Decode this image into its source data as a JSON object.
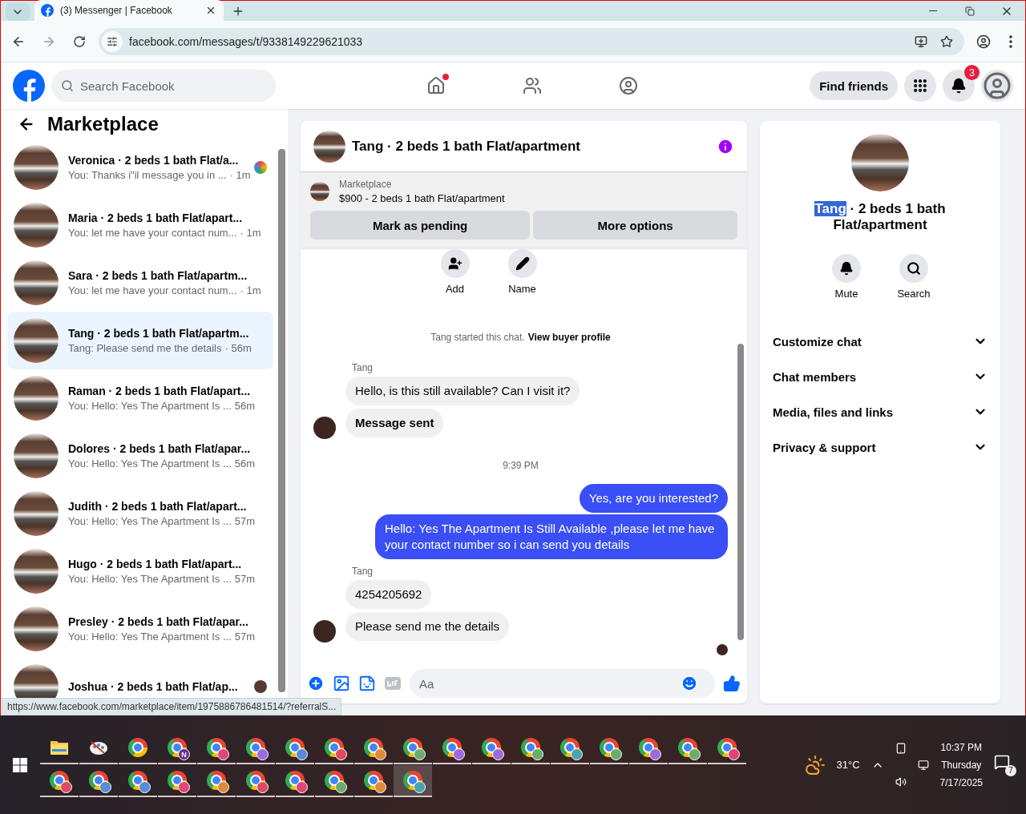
{
  "browser": {
    "tab_title": "(3) Messenger | Facebook",
    "url": "facebook.com/messages/t/9338149229621033",
    "status_url": "https://www.facebook.com/marketplace/item/1975886786481514/?referralS..."
  },
  "header": {
    "search_placeholder": "Search Facebook",
    "home_unread": true,
    "find_friends": "Find friends",
    "notification_count": "3"
  },
  "sidebar": {
    "title": "Marketplace",
    "conversations": [
      {
        "title": "Veronica · 2 beds 1 bath Flat/a...",
        "snippet": "You: Thanks i\"il message you in ...",
        "time": "· 1m",
        "selected": false,
        "seen_sticker": true,
        "seen_avatar": false
      },
      {
        "title": "Maria · 2 beds 1 bath Flat/apart...",
        "snippet": "You: let me have your contact num...",
        "time": "· 1m",
        "selected": false
      },
      {
        "title": "Sara · 2 beds 1 bath Flat/apartm...",
        "snippet": "You: let me have your contact num...",
        "time": "· 1m",
        "selected": false
      },
      {
        "title": "Tang · 2 beds 1 bath Flat/apartm...",
        "snippet": "Tang: Please send me the details",
        "time": "· 56m",
        "selected": true
      },
      {
        "title": "Raman · 2 beds 1 bath Flat/apart...",
        "snippet": "You: Hello: Yes The Apartment Is ...",
        "time": "56m",
        "selected": false
      },
      {
        "title": "Dolores · 2 beds 1 bath Flat/apar...",
        "snippet": "You: Hello: Yes The Apartment Is ...",
        "time": "56m",
        "selected": false
      },
      {
        "title": "Judith · 2 beds 1 bath Flat/apart...",
        "snippet": "You: Hello: Yes The Apartment Is ...",
        "time": "57m",
        "selected": false
      },
      {
        "title": "Hugo · 2 beds 1 bath Flat/apart...",
        "snippet": "You: Hello: Yes The Apartment Is ...",
        "time": "57m",
        "selected": false
      },
      {
        "title": "Presley · 2 beds 1 bath Flat/apar...",
        "snippet": "You: Hello: Yes The Apartment Is ...",
        "time": "57m",
        "selected": false
      },
      {
        "title": "Joshua · 2 beds 1 bath Flat/ap...",
        "selected": false,
        "seen_sticker": false,
        "seen_avatar": true
      }
    ]
  },
  "chat": {
    "title": "Tang · 2 beds 1 bath Flat/apartment",
    "listing": {
      "label": "Marketplace",
      "summary": "$900 - 2 beds 1 bath Flat/apartment"
    },
    "buttons": [
      "Mark as pending",
      "More options"
    ],
    "actions": [
      {
        "kind": "add",
        "label": "Add"
      },
      {
        "kind": "name",
        "label": "Name"
      }
    ],
    "started_note": "Tang started this chat.",
    "profile_link": "View buyer profile",
    "messages": [
      {
        "kind": "sender",
        "text": "Tang"
      },
      {
        "kind": "incoming",
        "text": "Hello, is this still available? Can I visit it?",
        "avatar": false,
        "bold": false
      },
      {
        "kind": "incoming",
        "text": "Message sent",
        "avatar": true,
        "bold": true
      },
      {
        "kind": "timestamp",
        "text": "9:39 PM"
      },
      {
        "kind": "outgoing",
        "text": "Yes, are you interested?"
      },
      {
        "kind": "outgoing",
        "text": "Hello: Yes The Apartment Is Still Available ,please let me have your contact number so i can send you details"
      },
      {
        "kind": "sender",
        "text": "Tang"
      },
      {
        "kind": "incoming",
        "text": "4254205692",
        "avatar": false,
        "bold": false
      },
      {
        "kind": "incoming",
        "text": "Please send me the details",
        "avatar": true,
        "bold": false
      }
    ],
    "composer_placeholder": "Aa"
  },
  "details": {
    "title_highlight": "Tang",
    "title_rest": "· 2 beds 1 bath Flat/apartment",
    "actions": [
      {
        "kind": "mute",
        "label": "Mute"
      },
      {
        "kind": "search",
        "label": "Search"
      }
    ],
    "sections": [
      {
        "label": "Customize chat",
        "expanded": false
      },
      {
        "label": "Chat members",
        "expanded": false
      },
      {
        "label": "Media, files and links",
        "expanded": false
      },
      {
        "label": "Privacy & support",
        "expanded": false
      }
    ]
  },
  "taskbar": {
    "rows": [
      [
        {
          "kind": "folder",
          "selected": false
        },
        {
          "kind": "paint",
          "selected": false
        },
        {
          "kind": "chrome",
          "selected": false
        },
        {
          "kind": "profile",
          "color": "#6a2c91",
          "letter": "N",
          "selected": false
        },
        {
          "kind": "profile",
          "color": "#e0457b",
          "selected": false
        },
        {
          "kind": "profile",
          "color": "#9c6ade",
          "selected": false
        },
        {
          "kind": "profile",
          "color": "#5b8ad8",
          "selected": false
        },
        {
          "kind": "profile",
          "color": "#e04a5f",
          "selected": false
        },
        {
          "kind": "profile",
          "color": "#e08a3c",
          "selected": false
        },
        {
          "kind": "profile",
          "color": "#6bab6b",
          "selected": false
        },
        {
          "kind": "profile",
          "color": "#9c6ade",
          "selected": false
        },
        {
          "kind": "profile",
          "color": "#9c6ade",
          "selected": false
        },
        {
          "kind": "profile",
          "color": "#6bab6b",
          "selected": false
        },
        {
          "kind": "profile",
          "color": "#4aa3b0",
          "selected": false
        },
        {
          "kind": "profile",
          "color": "#6bab6b",
          "selected": false
        },
        {
          "kind": "profile",
          "color": "#9c6ade",
          "selected": false
        },
        {
          "kind": "profile",
          "color": "#6bab6b",
          "selected": false
        },
        {
          "kind": "profile",
          "color": "#e0457b",
          "selected": false
        }
      ],
      [
        {
          "kind": "profile",
          "color": "#e04a5f",
          "selected": false
        },
        {
          "kind": "profile",
          "color": "#5b8ad8",
          "selected": false
        },
        {
          "kind": "profile",
          "color": "#5b8ad8",
          "selected": false
        },
        {
          "kind": "profile",
          "color": "#e0457b",
          "selected": false
        },
        {
          "kind": "profile",
          "color": "#e08a3c",
          "selected": false
        },
        {
          "kind": "profile",
          "color": "#e04a5f",
          "selected": false
        },
        {
          "kind": "profile",
          "color": "#e0457b",
          "selected": false
        },
        {
          "kind": "profile",
          "color": "#6bab6b",
          "selected": false
        },
        {
          "kind": "profile",
          "color": "#e08a3c",
          "selected": false
        },
        {
          "kind": "profile",
          "color": "#4aa3b0",
          "selected": true
        }
      ]
    ],
    "temperature": "31°C",
    "time": "10:37 PM",
    "day": "Thursday",
    "date": "7/17/2025",
    "notification_count": "7"
  }
}
